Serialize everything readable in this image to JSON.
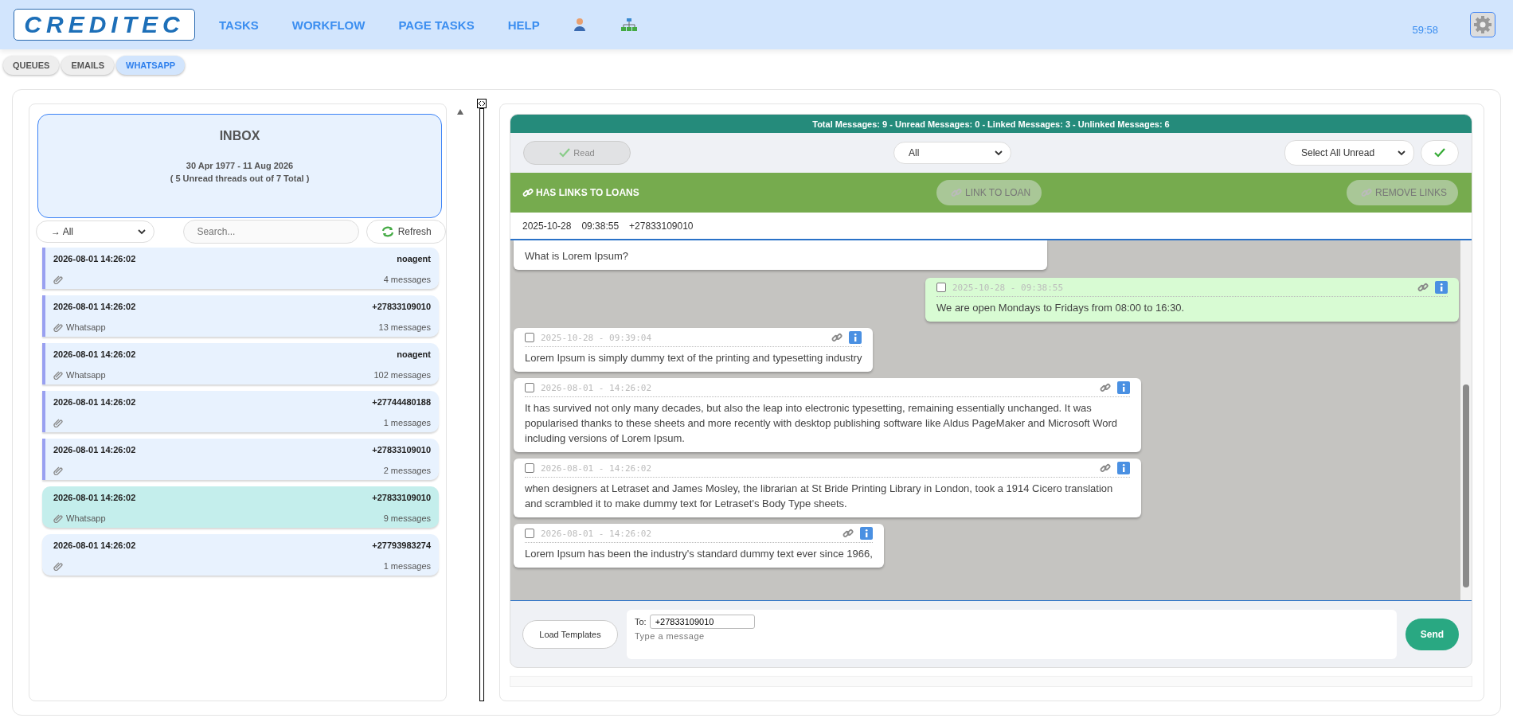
{
  "header": {
    "logo": "CREDITEC",
    "nav": [
      {
        "label": "TASKS"
      },
      {
        "label": "WORKFLOW"
      },
      {
        "label": "PAGE TASKS"
      },
      {
        "label": "HELP"
      }
    ],
    "timer": "59:58"
  },
  "tabs": [
    {
      "label": "QUEUES",
      "selected": false
    },
    {
      "label": "EMAILS",
      "selected": false
    },
    {
      "label": "WHATSAPP",
      "selected": true
    }
  ],
  "inbox": {
    "title": "INBOX",
    "range": "30 Apr 1977 - 11 Aug 2026",
    "summary": "( 5 Unread threads out of 7 Total )"
  },
  "filter": {
    "value": "→ All"
  },
  "search": {
    "placeholder": "Search..."
  },
  "refresh": "Refresh",
  "threads": [
    {
      "time": "2026-08-01 14:26:02",
      "contact": "noagent",
      "count": "4 messages",
      "unread": true,
      "selected": false
    },
    {
      "time": "2026-08-01 14:26:02",
      "contact": "+27833109010",
      "channel": "Whatsapp",
      "count": "13 messages",
      "unread": true,
      "selected": false
    },
    {
      "time": "2026-08-01 14:26:02",
      "contact": "noagent",
      "channel": "Whatsapp",
      "count": "102 messages",
      "unread": true,
      "selected": false
    },
    {
      "time": "2026-08-01 14:26:02",
      "contact": "+27744480188",
      "count": "1 messages",
      "unread": true,
      "selected": false
    },
    {
      "time": "2026-08-01 14:26:02",
      "contact": "+27833109010",
      "count": "2 messages",
      "unread": true,
      "selected": false
    },
    {
      "time": "2026-08-01 14:26:02",
      "contact": "+27833109010",
      "channel": "Whatsapp",
      "count": "9 messages",
      "unread": false,
      "selected": true
    },
    {
      "time": "2026-08-01 14:26:02",
      "contact": "+27793983274",
      "count": "1 messages",
      "unread": false,
      "selected": false
    }
  ],
  "chat": {
    "stats": "Total Messages: 9 - Unread Messages: 0 - Linked Messages: 3 - Unlinked Messages: 6",
    "read_button": {
      "label": "Read",
      "disabled": true
    },
    "filter": "All",
    "select_all": "Select All Unread",
    "links_title": "HAS LINKS TO LOANS",
    "link_button": "LINK TO LOAN",
    "remove_button": "REMOVE LINKS",
    "info": {
      "date": "2025-10-28",
      "time": "09:38:55",
      "phone": "+27833109010"
    },
    "messages": [
      {
        "kind": "incoming",
        "text": "What is Lorem Ipsum?"
      },
      {
        "kind": "outgoing",
        "time": "2025-10-28 - 09:38:55",
        "text": "We are open Mondays to Fridays from 08:00 to 16:30.",
        "checked": false
      },
      {
        "kind": "incoming",
        "time": "2025-10-28 - 09:39:04",
        "text": "Lorem Ipsum is simply dummy text of the printing and typesetting industry",
        "checked": false
      },
      {
        "kind": "incoming",
        "time": "2026-08-01 - 14:26:02",
        "text": "It has survived not only many decades, but also the leap into electronic typesetting, remaining essentially unchanged. It was popularised thanks to these sheets and more recently with desktop publishing software like Aldus PageMaker and Microsoft Word including versions of Lorem Ipsum.",
        "checked": false
      },
      {
        "kind": "incoming",
        "time": "2026-08-01 - 14:26:02",
        "text": "when designers at Letraset and James Mosley, the librarian at St Bride Printing Library in London, took a 1914 Cicero translation and scrambled it to make dummy text for Letraset's Body Type sheets.",
        "checked": false
      },
      {
        "kind": "incoming",
        "time": "2026-08-01 - 14:26:02",
        "text": "Lorem Ipsum has been the industry's standard dummy text ever since 1966,",
        "checked": false
      }
    ],
    "composer": {
      "templates": "Load Templates",
      "to_label": "To:",
      "to": "+27833109010",
      "placeholder": "Type a message",
      "send": "Send"
    }
  }
}
